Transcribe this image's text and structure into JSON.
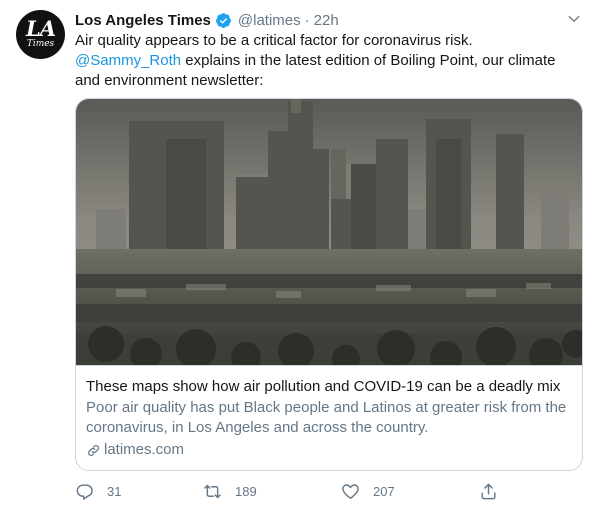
{
  "account": {
    "avatar_text_top": "LA",
    "avatar_text_bottom": "Times",
    "name": "Los Angeles Times",
    "handle": "@latimes",
    "separator": "·",
    "time": "22h"
  },
  "tweet": {
    "text_before": "Air quality appears to be a critical factor for coronavirus risk. ",
    "mention": "@Sammy_Roth",
    "text_after": " explains in the latest edition of Boiling Point, our climate and environment newsletter:"
  },
  "card": {
    "image_alt": "Hazy downtown Los Angeles skyline",
    "title": "These maps show how air pollution and COVID-19 can be a deadly mix",
    "description": "Poor air quality has put Black people and Latinos at greater risk from the coronavirus, in Los Angeles and across the country.",
    "domain": "latimes.com"
  },
  "actions": {
    "reply_count": "31",
    "retweet_count": "189",
    "like_count": "207"
  },
  "colors": {
    "link": "#1b95e0",
    "secondary_text": "#657786",
    "verified": "#1da1f2",
    "border": "#ccd6dd"
  },
  "icons": [
    "verified-badge-icon",
    "chevron-down-icon",
    "link-icon",
    "reply-icon",
    "retweet-icon",
    "like-icon",
    "share-icon"
  ]
}
